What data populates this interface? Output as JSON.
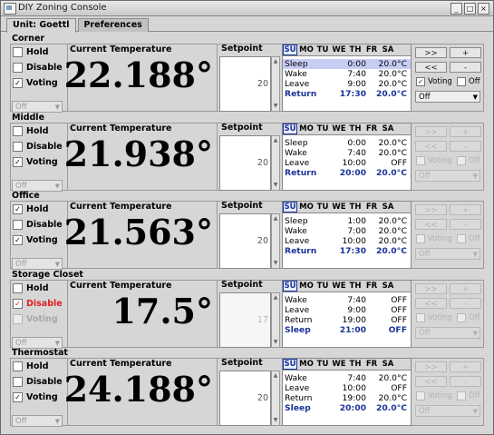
{
  "window": {
    "title": "DIY Zoning Console",
    "buttons": [
      "_",
      "□",
      "×"
    ]
  },
  "tabs": [
    "Unit: Goettl",
    "Preferences"
  ],
  "labels": {
    "current_temperature": "Current Temperature",
    "setpoint": "Setpoint",
    "hold": "Hold",
    "disable": "Disable",
    "voting": "Voting",
    "off": "Off"
  },
  "days": [
    "SU",
    "MO",
    "TU",
    "WE",
    "TH",
    "FR",
    "SA"
  ],
  "controls": {
    "fwd": ">>",
    "back": "<<",
    "plus": "+",
    "minus": "-"
  },
  "zones": [
    {
      "name": "Corner",
      "temperature": "22.188°",
      "setpoint": "20",
      "hold": false,
      "disable": false,
      "voting": true,
      "mode": "Off",
      "control_mode": "Off",
      "control_voting": true,
      "control_off": false,
      "controls_enabled": true,
      "selected_day": "SU",
      "highlight_row": 0,
      "schedule": [
        {
          "label": "Sleep",
          "time": "0:00",
          "temp": "20.0°C"
        },
        {
          "label": "Wake",
          "time": "7:40",
          "temp": "20.0°C"
        },
        {
          "label": "Leave",
          "time": "9:00",
          "temp": "20.0°C"
        },
        {
          "label": "Return",
          "time": "17:30",
          "temp": "20.0°C"
        }
      ],
      "current_row": 3
    },
    {
      "name": "Middle",
      "temperature": "21.938°",
      "setpoint": "20",
      "hold": false,
      "disable": false,
      "voting": true,
      "mode": "Off",
      "control_mode": "Off",
      "control_voting": false,
      "control_off": false,
      "controls_enabled": false,
      "selected_day": "SU",
      "highlight_row": -1,
      "schedule": [
        {
          "label": "Sleep",
          "time": "0:00",
          "temp": "20.0°C"
        },
        {
          "label": "Wake",
          "time": "7:40",
          "temp": "20.0°C"
        },
        {
          "label": "Leave",
          "time": "10:00",
          "temp": "OFF"
        },
        {
          "label": "Return",
          "time": "20:00",
          "temp": "20.0°C"
        }
      ],
      "current_row": 3
    },
    {
      "name": "Office",
      "temperature": "21.563°",
      "setpoint": "20",
      "hold": true,
      "disable": false,
      "voting": true,
      "mode": "Off",
      "control_mode": "Off",
      "control_voting": false,
      "control_off": false,
      "controls_enabled": false,
      "selected_day": "SU",
      "highlight_row": -1,
      "schedule": [
        {
          "label": "Sleep",
          "time": "1:00",
          "temp": "20.0°C"
        },
        {
          "label": "Wake",
          "time": "7:00",
          "temp": "20.0°C"
        },
        {
          "label": "Leave",
          "time": "10:00",
          "temp": "20.0°C"
        },
        {
          "label": "Return",
          "time": "17:30",
          "temp": "20.0°C"
        }
      ],
      "current_row": 3
    },
    {
      "name": "Storage Closet",
      "temperature": "17.5°",
      "setpoint": "17",
      "hold": false,
      "disable": true,
      "voting": false,
      "mode": "Off",
      "control_mode": "Off",
      "control_voting": false,
      "control_off": false,
      "controls_enabled": false,
      "selected_day": "SU",
      "highlight_row": -1,
      "schedule": [
        {
          "label": "Wake",
          "time": "7:40",
          "temp": "OFF"
        },
        {
          "label": "Leave",
          "time": "9:00",
          "temp": "OFF"
        },
        {
          "label": "Return",
          "time": "19:00",
          "temp": "OFF"
        },
        {
          "label": "Sleep",
          "time": "21:00",
          "temp": "OFF"
        }
      ],
      "current_row": 3
    },
    {
      "name": "Thermostat",
      "temperature": "24.188°",
      "setpoint": "20",
      "hold": false,
      "disable": false,
      "voting": true,
      "mode": "Off",
      "control_mode": "Off",
      "control_voting": false,
      "control_off": false,
      "controls_enabled": false,
      "selected_day": "SU",
      "highlight_row": -1,
      "schedule": [
        {
          "label": "Wake",
          "time": "7:40",
          "temp": "20.0°C"
        },
        {
          "label": "Leave",
          "time": "10:00",
          "temp": "OFF"
        },
        {
          "label": "Return",
          "time": "19:00",
          "temp": "20.0°C"
        },
        {
          "label": "Sleep",
          "time": "20:00",
          "temp": "20.0°C"
        }
      ],
      "current_row": 3
    }
  ]
}
